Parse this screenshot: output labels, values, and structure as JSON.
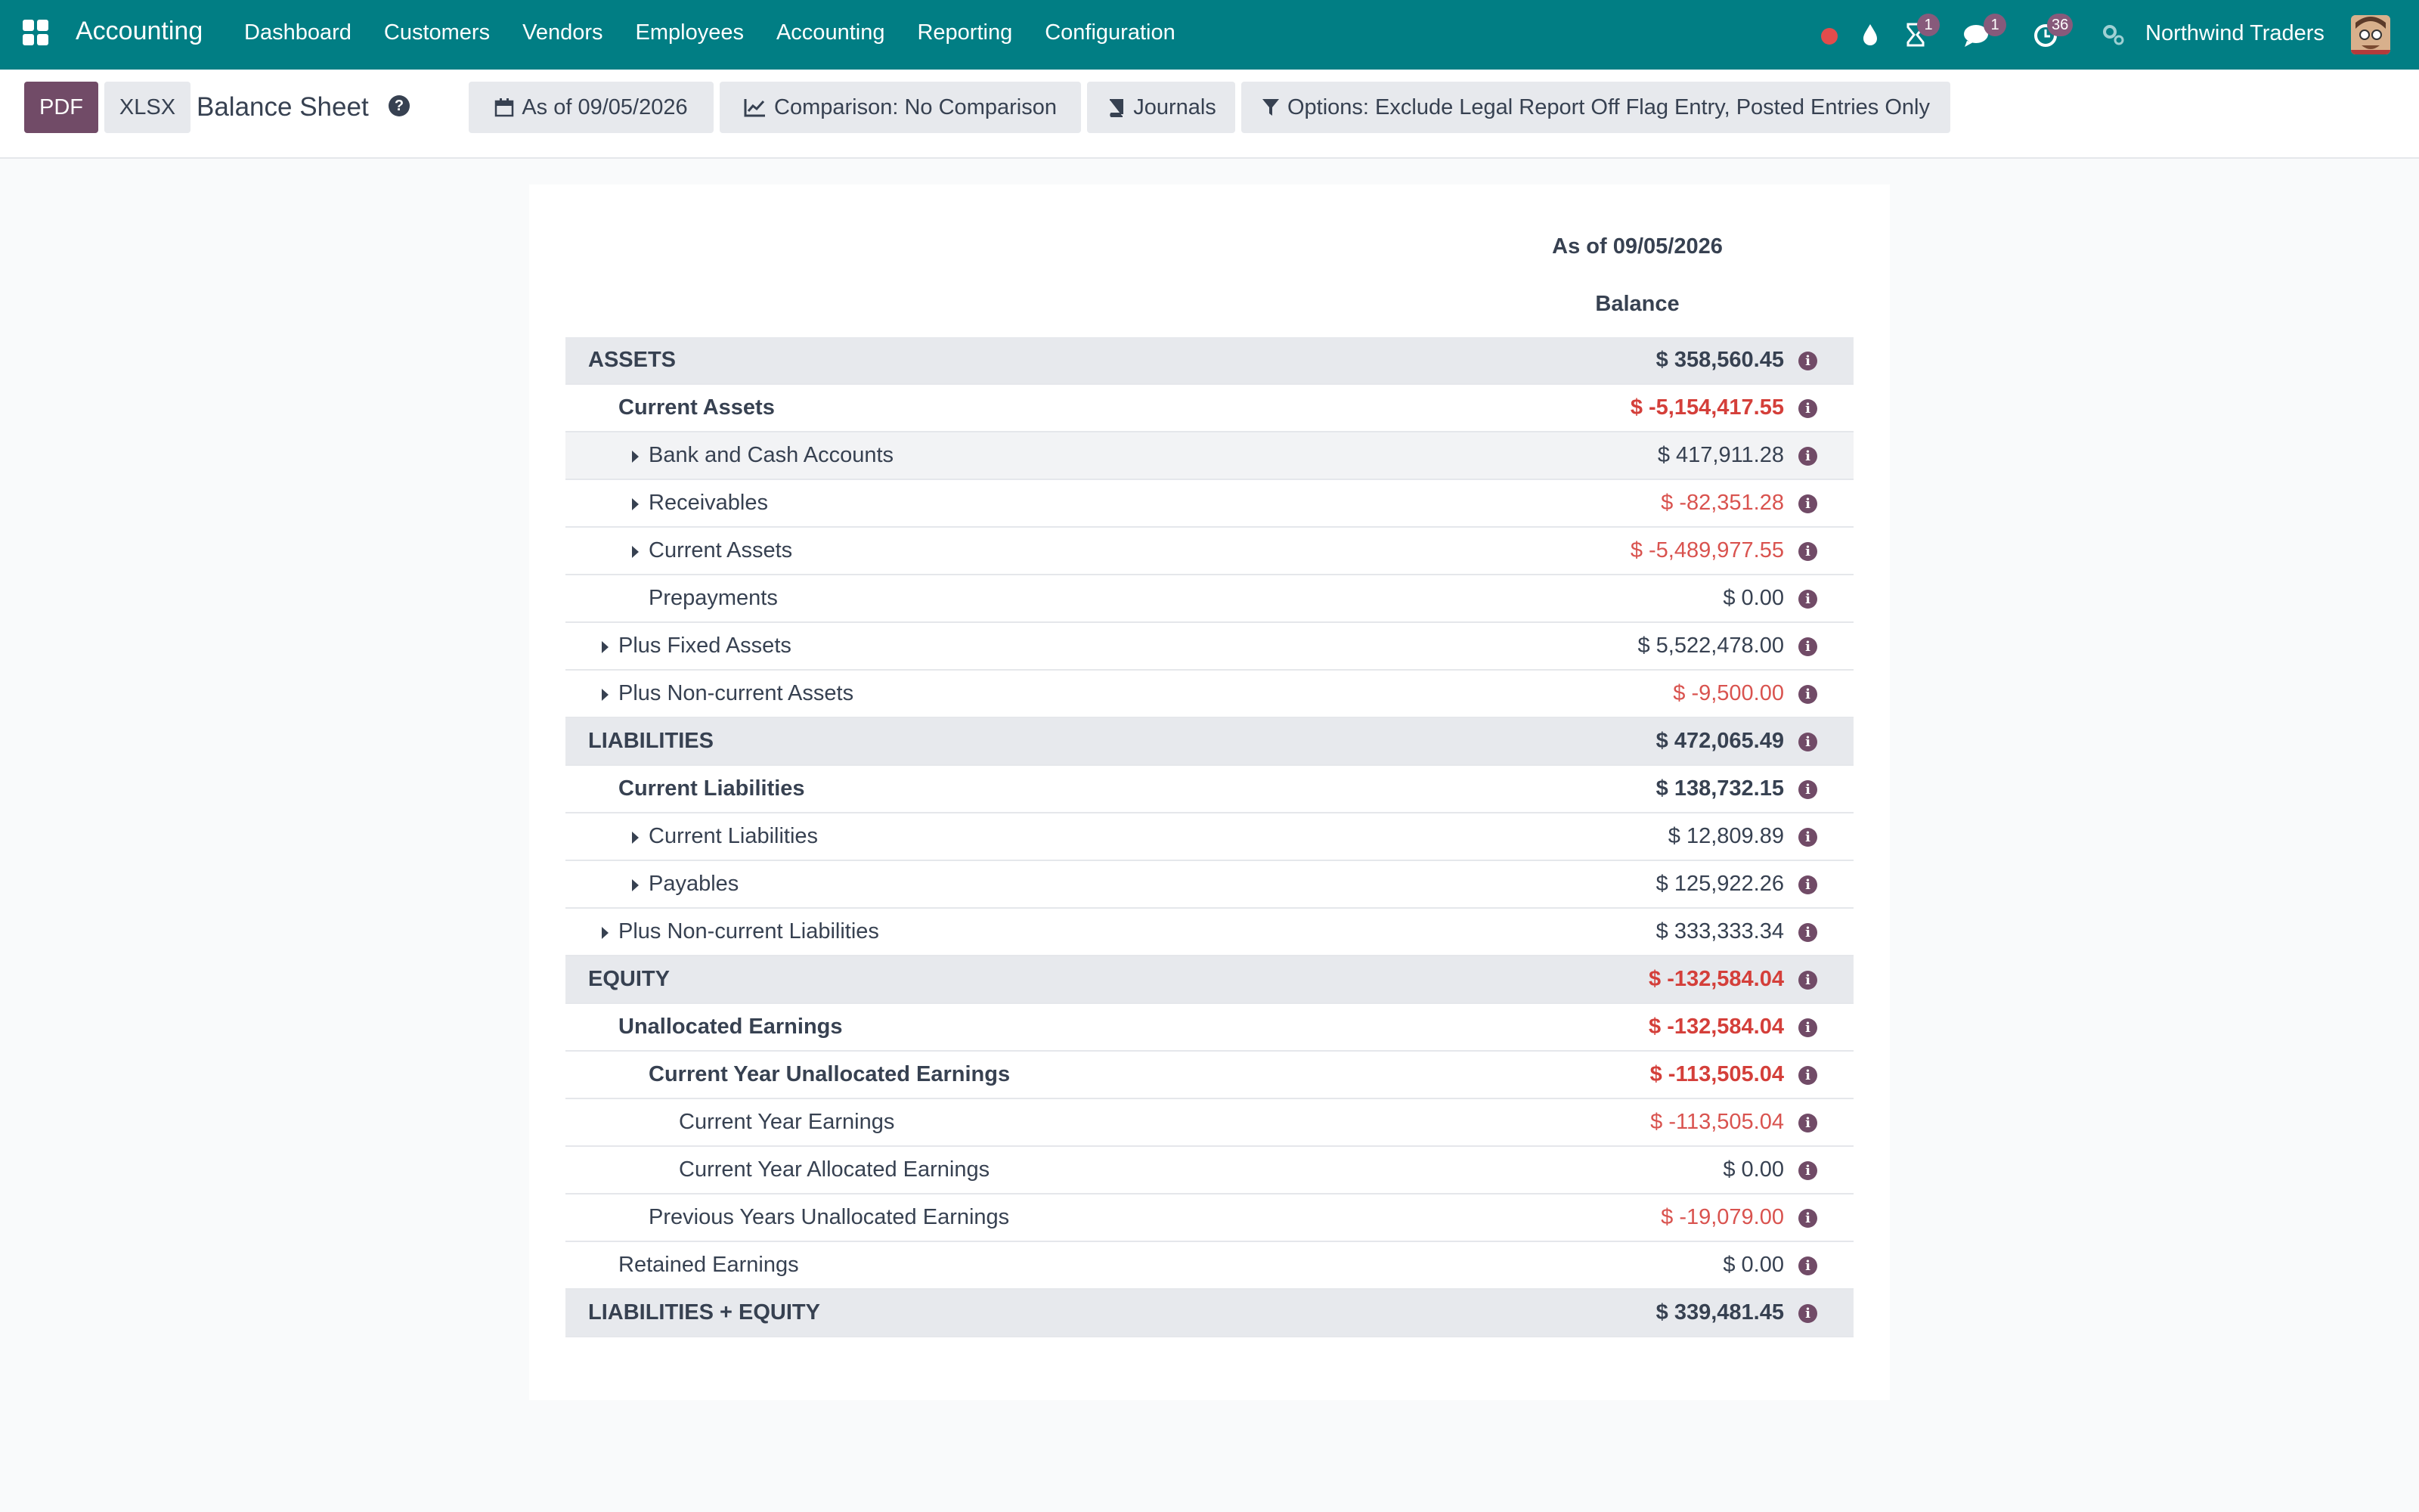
{
  "navbar": {
    "brand": "Accounting",
    "menu": [
      "Dashboard",
      "Customers",
      "Vendors",
      "Employees",
      "Accounting",
      "Reporting",
      "Configuration"
    ],
    "badges": {
      "activities": "1",
      "messages": "1",
      "updates": "36"
    },
    "company": "Northwind Traders",
    "accent_color": "#017e84",
    "badge_color": "#875a7b"
  },
  "control": {
    "pdf": "PDF",
    "xlsx": "XLSX",
    "title": "Balance Sheet",
    "filters": {
      "date": "As of 09/05/2026",
      "comparison": "Comparison: No Comparison",
      "journals": "Journals",
      "options": "Options: Exclude Legal Report Off Flag Entry, Posted Entries Only"
    }
  },
  "report": {
    "column_date": "As of 09/05/2026",
    "column_balance": "Balance",
    "rows": [
      {
        "label": "ASSETS",
        "amount": "$ 358,560.45",
        "level": 0,
        "style": "section",
        "bold": true,
        "negative": false,
        "caret": false
      },
      {
        "label": "Current Assets",
        "amount": "$ -5,154,417.55",
        "level": 1,
        "style": "",
        "bold": true,
        "negative": true,
        "caret": false
      },
      {
        "label": "Bank and Cash Accounts",
        "amount": "$ 417,911.28",
        "level": 2,
        "style": "shaded",
        "bold": false,
        "negative": false,
        "caret": true
      },
      {
        "label": "Receivables",
        "amount": "$ -82,351.28",
        "level": 2,
        "style": "",
        "bold": false,
        "negative": true,
        "caret": true
      },
      {
        "label": "Current Assets",
        "amount": "$ -5,489,977.55",
        "level": 2,
        "style": "",
        "bold": false,
        "negative": true,
        "caret": true
      },
      {
        "label": "Prepayments",
        "amount": "$ 0.00",
        "level": 2,
        "style": "",
        "bold": false,
        "negative": false,
        "caret": false
      },
      {
        "label": "Plus Fixed Assets",
        "amount": "$ 5,522,478.00",
        "level": 1,
        "style": "",
        "bold": false,
        "negative": false,
        "caret": true
      },
      {
        "label": "Plus Non-current Assets",
        "amount": "$ -9,500.00",
        "level": 1,
        "style": "",
        "bold": false,
        "negative": true,
        "caret": true
      },
      {
        "label": "LIABILITIES",
        "amount": "$ 472,065.49",
        "level": 0,
        "style": "section",
        "bold": true,
        "negative": false,
        "caret": false
      },
      {
        "label": "Current Liabilities",
        "amount": "$ 138,732.15",
        "level": 1,
        "style": "",
        "bold": true,
        "negative": false,
        "caret": false
      },
      {
        "label": "Current Liabilities",
        "amount": "$ 12,809.89",
        "level": 2,
        "style": "",
        "bold": false,
        "negative": false,
        "caret": true
      },
      {
        "label": "Payables",
        "amount": "$ 125,922.26",
        "level": 2,
        "style": "",
        "bold": false,
        "negative": false,
        "caret": true
      },
      {
        "label": "Plus Non-current Liabilities",
        "amount": "$ 333,333.34",
        "level": 1,
        "style": "",
        "bold": false,
        "negative": false,
        "caret": true
      },
      {
        "label": "EQUITY",
        "amount": "$ -132,584.04",
        "level": 0,
        "style": "section",
        "bold": true,
        "negative": true,
        "caret": false
      },
      {
        "label": "Unallocated Earnings",
        "amount": "$ -132,584.04",
        "level": 1,
        "style": "",
        "bold": true,
        "negative": true,
        "caret": false
      },
      {
        "label": "Current Year Unallocated Earnings",
        "amount": "$ -113,505.04",
        "level": 2,
        "style": "",
        "bold": true,
        "negative": true,
        "caret": false
      },
      {
        "label": "Current Year Earnings",
        "amount": "$ -113,505.04",
        "level": 3,
        "style": "",
        "bold": false,
        "negative": true,
        "caret": false
      },
      {
        "label": "Current Year Allocated Earnings",
        "amount": "$ 0.00",
        "level": 3,
        "style": "",
        "bold": false,
        "negative": false,
        "caret": false
      },
      {
        "label": "Previous Years Unallocated Earnings",
        "amount": "$ -19,079.00",
        "level": 2,
        "style": "",
        "bold": false,
        "negative": true,
        "caret": false
      },
      {
        "label": "Retained Earnings",
        "amount": "$ 0.00",
        "level": 1,
        "style": "",
        "bold": false,
        "negative": false,
        "caret": false
      },
      {
        "label": "LIABILITIES + EQUITY",
        "amount": "$ 339,481.45",
        "level": 0,
        "style": "section",
        "bold": true,
        "negative": false,
        "caret": false
      }
    ]
  }
}
